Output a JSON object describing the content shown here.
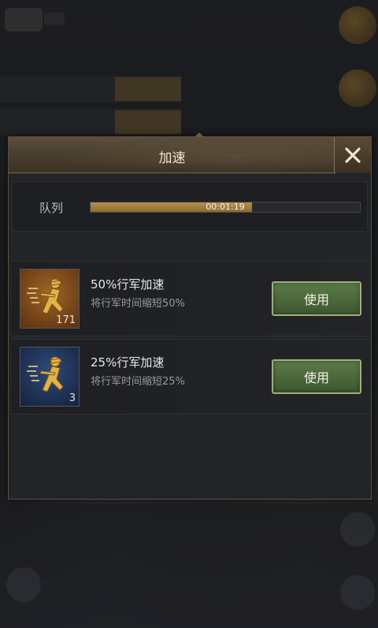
{
  "dialog": {
    "title": "加速",
    "close_icon": "close-icon"
  },
  "queue": {
    "label": "队列",
    "time": "00:01:19",
    "progress": 0.6
  },
  "items": [
    {
      "title": "50%行军加速",
      "description": "将行军时间缩短50%",
      "count": "171",
      "icon": "marching-soldier-icon",
      "icon_color": "#9a5f24",
      "button_label": "使用"
    },
    {
      "title": "25%行军加速",
      "description": "将行军时间缩短25%",
      "count": "3",
      "icon": "marching-soldier-icon",
      "icon_color": "#2b4676",
      "button_label": "使用"
    }
  ],
  "colors": {
    "accent_gold": "#b8914a",
    "button_green": "#4c6a3c"
  }
}
